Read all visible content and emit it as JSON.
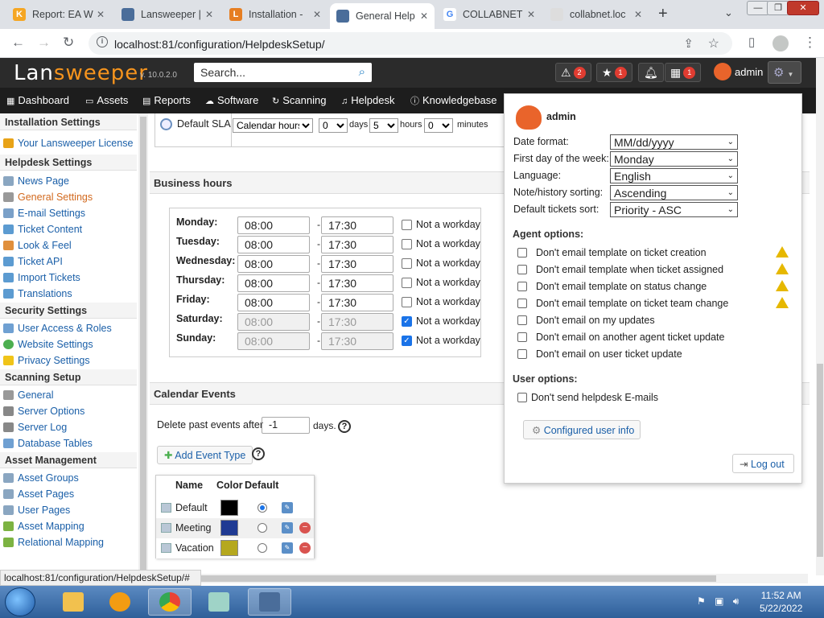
{
  "browser": {
    "tabs": [
      {
        "title": "Report: EA W",
        "icon": "lansweeper-report-icon",
        "fav_color": "#f5a623",
        "fav_letter": "K"
      },
      {
        "title": "Lansweeper |",
        "icon": "lansweeper-icon",
        "fav_color": "#4a6d9a",
        "fav_letter": ""
      },
      {
        "title": "Installation -",
        "icon": "installation-icon",
        "fav_color": "#e67e22",
        "fav_letter": "L"
      },
      {
        "title": "General Help",
        "icon": "lansweeper-icon",
        "fav_color": "#4a6d9a",
        "fav_letter": "",
        "active": true
      },
      {
        "title": "COLLABNET",
        "icon": "google-icon",
        "fav_color": "#ffffff",
        "fav_letter": "G"
      },
      {
        "title": "collabnet.loc",
        "icon": "globe-icon",
        "fav_color": "#dddddd",
        "fav_letter": ""
      }
    ],
    "url": "localhost:81/configuration/HelpdeskSetup/",
    "status_url": "localhost:81/configuration/HelpdeskSetup/#"
  },
  "header": {
    "logo_text_1": "Lan",
    "logo_text_2": "sweeper",
    "version": "v. 10.0.2.0",
    "search_placeholder": "Search...",
    "alerts_count": "2",
    "favorites_count": "1",
    "calendar_count": "1",
    "username": "admin"
  },
  "nav": {
    "items": [
      "Dashboard",
      "Assets",
      "Reports",
      "Software",
      "Scanning",
      "Helpdesk",
      "Knowledgebase"
    ]
  },
  "sidebar": {
    "sections": [
      {
        "title": "Installation Settings",
        "items": [
          "Your Lansweeper License"
        ]
      },
      {
        "title": "Helpdesk Settings",
        "items": [
          "News Page",
          "General Settings",
          "E-mail Settings",
          "Ticket Content",
          "Look & Feel",
          "Ticket API",
          "Import Tickets",
          "Translations"
        ]
      },
      {
        "title": "Security Settings",
        "items": [
          "User Access & Roles",
          "Website Settings",
          "Privacy Settings"
        ]
      },
      {
        "title": "Scanning Setup",
        "items": [
          "General",
          "Server Options",
          "Server Log",
          "Database Tables"
        ]
      },
      {
        "title": "Asset Management",
        "items": [
          "Asset Groups",
          "Asset Pages",
          "User Pages",
          "Asset Mapping",
          "Relational Mapping"
        ]
      }
    ],
    "active_item": "General Settings"
  },
  "sla": {
    "label": "Default SLA",
    "unit": "Calendar hours",
    "days_value": "0",
    "days_label": "days",
    "hours_value": "5",
    "hours_label": "hours",
    "minutes_value": "0",
    "minutes_label": "minutes"
  },
  "business_hours": {
    "title": "Business hours",
    "not_workday_label": "Not a workday",
    "days": [
      {
        "day": "Monday:",
        "start": "08:00",
        "end": "17:30",
        "not_workday": false
      },
      {
        "day": "Tuesday:",
        "start": "08:00",
        "end": "17:30",
        "not_workday": false
      },
      {
        "day": "Wednesday:",
        "start": "08:00",
        "end": "17:30",
        "not_workday": false
      },
      {
        "day": "Thursday:",
        "start": "08:00",
        "end": "17:30",
        "not_workday": false
      },
      {
        "day": "Friday:",
        "start": "08:00",
        "end": "17:30",
        "not_workday": false
      },
      {
        "day": "Saturday:",
        "start": "08:00",
        "end": "17:30",
        "not_workday": true
      },
      {
        "day": "Sunday:",
        "start": "08:00",
        "end": "17:30",
        "not_workday": true
      }
    ]
  },
  "calendar_events": {
    "title": "Calendar Events",
    "delete_label": "Delete past events after",
    "delete_value": "-1",
    "delete_unit": "days.",
    "add_button": "Add Event Type",
    "columns": [
      "Name",
      "Color",
      "Default"
    ],
    "rows": [
      {
        "name": "Default",
        "color": "#000000",
        "default": true,
        "deletable": false
      },
      {
        "name": "Meeting",
        "color": "#1f3a93",
        "default": false,
        "deletable": true
      },
      {
        "name": "Vacation",
        "color": "#b5a81e",
        "default": false,
        "deletable": true
      }
    ]
  },
  "user_panel": {
    "username": "admin",
    "fields": [
      {
        "label": "Date format:",
        "value": "MM/dd/yyyy"
      },
      {
        "label": "First day of the week:",
        "value": "Monday"
      },
      {
        "label": "Language:",
        "value": "English"
      },
      {
        "label": "Note/history sorting:",
        "value": "Ascending"
      },
      {
        "label": "Default tickets sort:",
        "value": "Priority - ASC"
      }
    ],
    "agent_options_title": "Agent options:",
    "agent_options": [
      {
        "label": "Don't email template on ticket creation",
        "warning": true
      },
      {
        "label": "Don't email template when ticket assigned",
        "warning": true
      },
      {
        "label": "Don't email template on status change",
        "warning": true
      },
      {
        "label": "Don't email template on ticket team change",
        "warning": true
      },
      {
        "label": "Don't email on my updates",
        "warning": false
      },
      {
        "label": "Don't email on another agent ticket update",
        "warning": false
      },
      {
        "label": "Don't email on user ticket update",
        "warning": false
      }
    ],
    "user_options_title": "User options:",
    "user_options": [
      "Don't send helpdesk E-mails"
    ],
    "configured_button": "Configured user info",
    "logout_button": "Log out"
  },
  "taskbar": {
    "time": "11:52 AM",
    "date": "5/22/2022"
  }
}
